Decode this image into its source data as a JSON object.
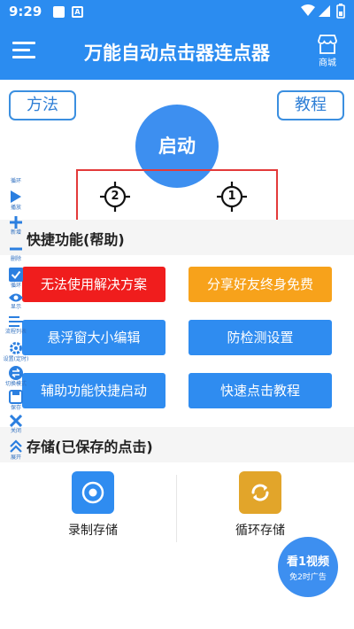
{
  "status_bar": {
    "time": "9:29",
    "notification_letter": "A"
  },
  "app_bar": {
    "title": "万能自动点击器连点器",
    "shop_label": "商城"
  },
  "top_controls": {
    "method_label": "方法",
    "tutorial_label": "教程",
    "start_label": "启动"
  },
  "targets": [
    {
      "number": "2"
    },
    {
      "number": "1"
    }
  ],
  "side_toolbar": [
    {
      "label": "循环",
      "icon": "loop-icon"
    },
    {
      "label": "播放",
      "icon": "play-icon"
    },
    {
      "label": "新增",
      "icon": "plus-icon"
    },
    {
      "label": "删除",
      "icon": "minus-icon"
    },
    {
      "label": "循环",
      "icon": "checkbox-icon"
    },
    {
      "label": "显示",
      "icon": "eye-icon"
    },
    {
      "label": "流程列表",
      "icon": "list-icon"
    },
    {
      "label": "设置(定时)",
      "icon": "gear-icon"
    },
    {
      "label": "切换模式",
      "icon": "swap-icon"
    },
    {
      "label": "保存",
      "icon": "save-icon"
    },
    {
      "label": "关闭",
      "icon": "close-icon"
    },
    {
      "label": "展开",
      "icon": "chevron-up-icon"
    }
  ],
  "shortcuts": {
    "title": "快捷功能(帮助)",
    "buttons": [
      {
        "label": "无法使用解决方案",
        "color": "#f01d1d"
      },
      {
        "label": "分享好友终身免费",
        "color": "#f7a21b"
      },
      {
        "label": "悬浮窗大小编辑",
        "color": "#2f8cf0"
      },
      {
        "label": "防检测设置",
        "color": "#2f8cf0"
      },
      {
        "label": "辅助功能快捷启动",
        "color": "#2f8cf0"
      },
      {
        "label": "快速点击教程",
        "color": "#2f8cf0"
      }
    ]
  },
  "storage": {
    "title": "存储(已保存的点击)",
    "items": [
      {
        "label": "录制存储",
        "color": "#2f8cf0",
        "icon": "record-icon"
      },
      {
        "label": "循环存储",
        "color": "#e2a52a",
        "icon": "sync-icon"
      }
    ]
  },
  "video_ad": {
    "title": "看1视频",
    "subtitle": "免2时广告"
  },
  "colors": {
    "primary": "#2b8cf0",
    "danger": "#f01d1d",
    "warning": "#f7a21b",
    "highlight_box": "#e33a3a"
  }
}
